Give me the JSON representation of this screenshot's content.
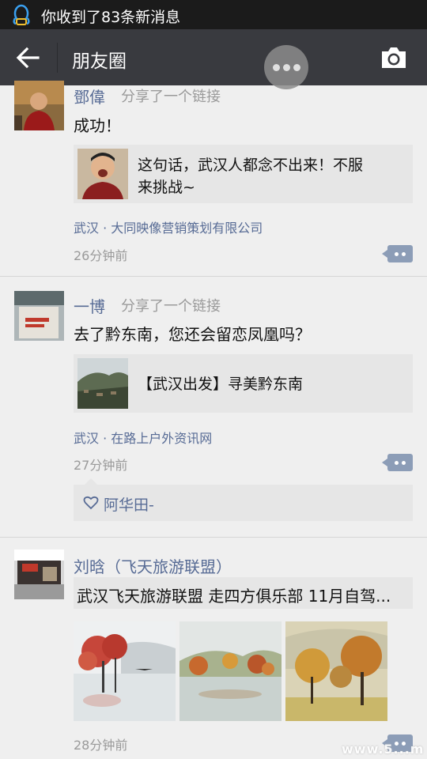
{
  "status_bar": {
    "notification": "你收到了83条新消息"
  },
  "header": {
    "title": "朋友圈",
    "back_icon": "arrow-left-icon",
    "camera_icon": "camera-icon"
  },
  "posts": [
    {
      "name": "鄧偉",
      "share_note": "分享了一个链接",
      "text": "成功！",
      "link_title_line1": "这句话，武汉人都念不出来！不服",
      "link_title_line2": "来挑战~",
      "location": "武汉 · 大同映像营销策划有限公司",
      "time": "26分钟前"
    },
    {
      "name": "一博",
      "share_note": "分享了一个链接",
      "text": "去了黔东南，您还会留恋凤凰吗？",
      "link_title": "【武汉出发】寻美黔东南",
      "location": "武汉 · 在路上户外资讯网",
      "time": "27分钟前",
      "likes": "阿华田-"
    },
    {
      "name": "刘晗（飞天旅游联盟）",
      "text": "武汉飞天旅游联盟 走四方俱乐部 11月自驾...",
      "time": "28分钟前"
    }
  ],
  "watermark": "www.5...m"
}
